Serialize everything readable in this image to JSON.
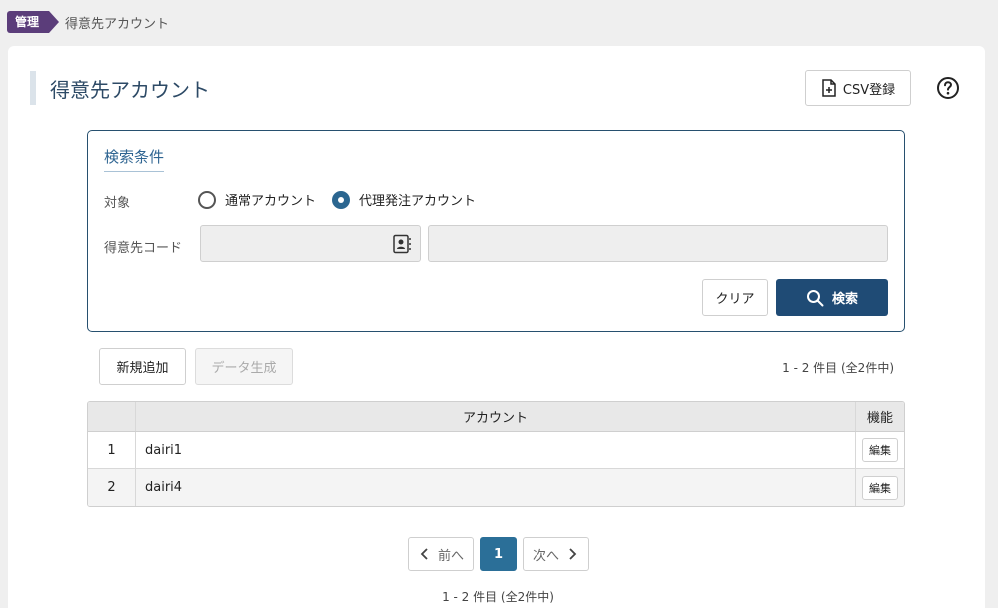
{
  "breadcrumb": {
    "section": "管理",
    "current": "得意先アカウント"
  },
  "header": {
    "title": "得意先アカウント",
    "csv_label": "CSV登録"
  },
  "search": {
    "title": "検索条件",
    "target_label": "対象",
    "options": [
      {
        "label": "通常アカウント",
        "selected": false
      },
      {
        "label": "代理発注アカウント",
        "selected": true
      }
    ],
    "code_label": "得意先コード",
    "code_value": "",
    "name_value": "",
    "clear_label": "クリア",
    "search_label": "検索"
  },
  "actions": {
    "new_label": "新規追加",
    "generate_label": "データ生成"
  },
  "results": {
    "count_text": "1 - 2 件目 (全2件中)",
    "columns": {
      "num": "",
      "account": "アカウント",
      "function": "機能"
    },
    "rows": [
      {
        "num": "1",
        "account": "dairi1",
        "edit_label": "編集"
      },
      {
        "num": "2",
        "account": "dairi4",
        "edit_label": "編集"
      }
    ]
  },
  "pagination": {
    "prev_label": "前へ",
    "current": "1",
    "next_label": "次へ"
  },
  "colors": {
    "brand": "#5b3d7a",
    "primary": "#1f4b75",
    "accent": "#2b6f98"
  }
}
